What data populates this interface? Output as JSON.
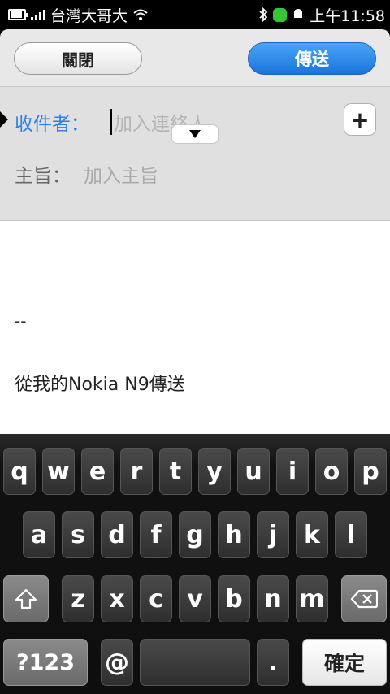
{
  "status_bar": {
    "operator": "台灣大哥大",
    "time": "上午11:58"
  },
  "toolbar": {
    "close_label": "關閉",
    "send_label": "傳送"
  },
  "recipients": {
    "label": "收件者：",
    "placeholder": "加入連絡人",
    "add_label": "+"
  },
  "subject": {
    "label": "主旨：",
    "placeholder": "加入主旨"
  },
  "body": {
    "separator": "--",
    "signature": "從我的Nokia N9傳送"
  },
  "keyboard": {
    "row1": [
      "q",
      "w",
      "e",
      "r",
      "t",
      "y",
      "u",
      "i",
      "o",
      "p"
    ],
    "row2": [
      "a",
      "s",
      "d",
      "f",
      "g",
      "h",
      "j",
      "k",
      "l"
    ],
    "row3": [
      "z",
      "x",
      "c",
      "v",
      "b",
      "n",
      "m"
    ],
    "symbols_label": "?123",
    "at_label": "@",
    "period_label": ".",
    "confirm_label": "確定"
  },
  "colors": {
    "accent": "#2b80e8",
    "send_button": "#1a74dc",
    "presence": "#34c634"
  }
}
